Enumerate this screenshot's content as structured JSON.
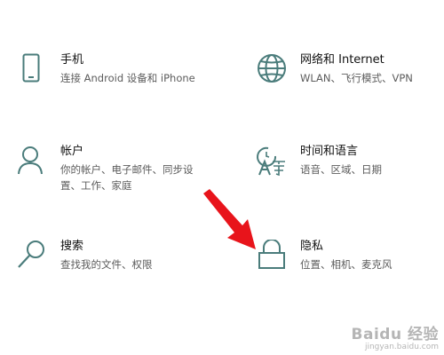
{
  "colors": {
    "icon": "#4a7c7b",
    "title": "#111111",
    "description": "#5c5c5c",
    "annotation_arrow": "#e8141b",
    "background": "#ffffff"
  },
  "settings": [
    {
      "id": "phone",
      "title": "手机",
      "description": "连接 Android 设备和 iPhone",
      "icon": "phone-icon"
    },
    {
      "id": "network",
      "title": "网络和 Internet",
      "description": "WLAN、飞行模式、VPN",
      "icon": "globe-icon"
    },
    {
      "id": "accounts",
      "title": "帐户",
      "description": "你的帐户、电子邮件、同步设置、工作、家庭",
      "icon": "person-icon"
    },
    {
      "id": "time-language",
      "title": "时间和语言",
      "description": "语音、区域、日期",
      "icon": "time-language-icon"
    },
    {
      "id": "search",
      "title": "搜索",
      "description": "查找我的文件、权限",
      "icon": "search-icon"
    },
    {
      "id": "privacy",
      "title": "隐私",
      "description": "位置、相机、麦克风",
      "icon": "lock-icon"
    }
  ],
  "watermark": {
    "logo": "Baidu 经验",
    "url": "jingyan.baidu.com"
  }
}
